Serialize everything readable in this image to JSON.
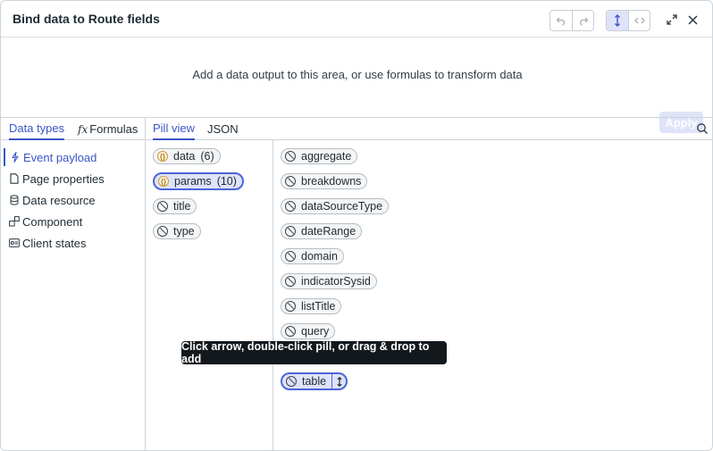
{
  "header": {
    "title": "Bind data to Route fields",
    "undo_icon": "undo-icon",
    "redo_icon": "redo-icon",
    "pill_view_icon": "up-down-arrows-icon",
    "code_view_icon": "code-icon",
    "expand_icon": "expand-icon",
    "close_icon": "close-icon"
  },
  "drop_area": {
    "message": "Add a data output to this area, or use formulas to transform data",
    "apply_label": "Apply"
  },
  "left_tabs": {
    "data_types": "Data types",
    "formulas": "Formulas"
  },
  "right_tabs": {
    "pill_view": "Pill view",
    "json": "JSON"
  },
  "sidebar": {
    "items": [
      {
        "label": "Event payload",
        "icon": "lightning-icon",
        "active": true
      },
      {
        "label": "Page properties",
        "icon": "page-icon"
      },
      {
        "label": "Data resource",
        "icon": "database-icon"
      },
      {
        "label": "Component",
        "icon": "component-icon"
      },
      {
        "label": "Client states",
        "icon": "client-state-icon"
      }
    ]
  },
  "middle": {
    "pills": [
      {
        "label": "data",
        "count": "(6)",
        "type": "object"
      },
      {
        "label": "params",
        "count": "(10)",
        "type": "object",
        "selected": true
      },
      {
        "label": "title",
        "type": "null"
      },
      {
        "label": "type",
        "type": "null"
      }
    ]
  },
  "fields": {
    "pills": [
      {
        "label": "aggregate"
      },
      {
        "label": "breakdowns"
      },
      {
        "label": "dataSourceType"
      },
      {
        "label": "dateRange"
      },
      {
        "label": "domain"
      },
      {
        "label": "indicatorSysid"
      },
      {
        "label": "listTitle"
      },
      {
        "label": "query"
      },
      {
        "label": "table",
        "selected": true
      }
    ]
  },
  "tooltip": "Click arrow, double-click pill, or drag & drop to add",
  "colors": {
    "accent": "#3b55c8",
    "selected_bg": "#dfe3fa",
    "tooltip_bg": "#13181c"
  }
}
